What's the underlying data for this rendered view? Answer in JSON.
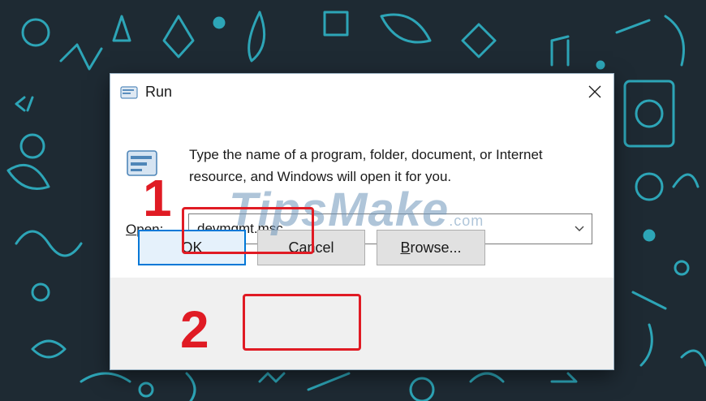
{
  "dialog": {
    "title": "Run",
    "description": "Type the name of a program, folder, document, or Internet resource, and Windows will open it for you.",
    "open_label_accel": "O",
    "open_label_rest": "pen:",
    "open_value": "devmgmt.msc",
    "buttons": {
      "ok": "OK",
      "cancel": "Cancel",
      "browse_accel": "B",
      "browse_rest": "rowse..."
    }
  },
  "annotations": {
    "step1": "1",
    "step2": "2",
    "highlight_color": "#e01b24"
  },
  "watermark": {
    "main": "TipsMake",
    "suffix": ".com"
  },
  "icons": [
    "run-icon",
    "close-icon",
    "chevron-down-icon"
  ],
  "colors": {
    "focus_border": "#0078d7",
    "wallpaper": "#1e2a33",
    "doodle": "#2fb3c6"
  }
}
